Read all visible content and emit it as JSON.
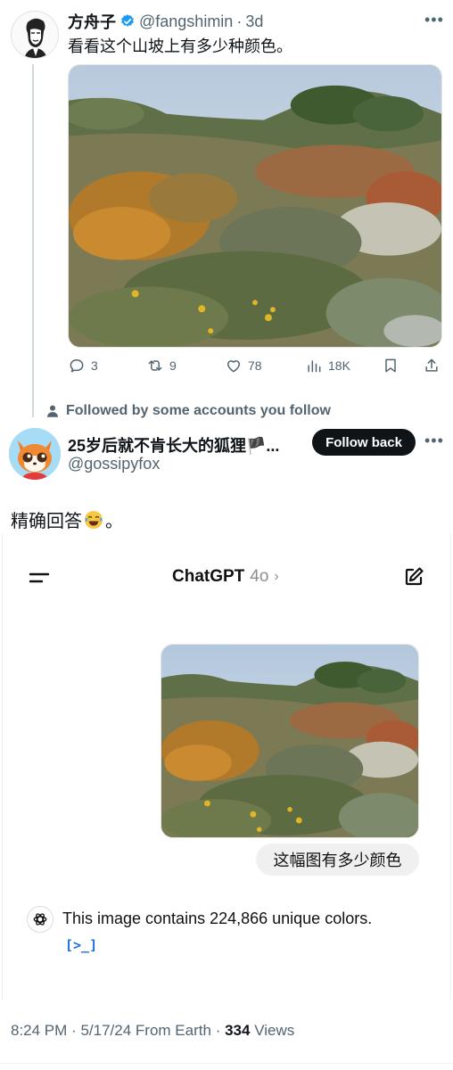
{
  "tweet1": {
    "name": "方舟子",
    "handle": "@fangshimin",
    "separator": "·",
    "time": "3d",
    "text": "看看这个山坡上有多少种颜色。",
    "stats": {
      "replies": "3",
      "retweets": "9",
      "likes": "78",
      "views": "18K"
    }
  },
  "follow_note": "Followed by some accounts you follow",
  "tweet2": {
    "name": "25岁后就不肯长大的狐狸🏴...",
    "handle": "@gossipyfox",
    "follow_label": "Follow back",
    "text": "精确回答",
    "text_suffix": "。"
  },
  "chatgpt": {
    "title": "ChatGPT",
    "model": "4o",
    "chevron": "›",
    "user_message": "这幅图有多少颜色",
    "answer": "This image contains 224,866 unique colors.",
    "code_icon": "[>_]"
  },
  "footer": {
    "time": "8:24 PM",
    "separator": "·",
    "date": "5/17/24",
    "source": "From Earth",
    "separator2": "·",
    "views": "334",
    "views_label": "Views"
  },
  "colors": {
    "text_primary": "#0f1419",
    "text_secondary": "#536471",
    "verified_blue": "#1d9bf0",
    "follow_button": "#0f1419",
    "code_blue": "#1d6fe0"
  }
}
